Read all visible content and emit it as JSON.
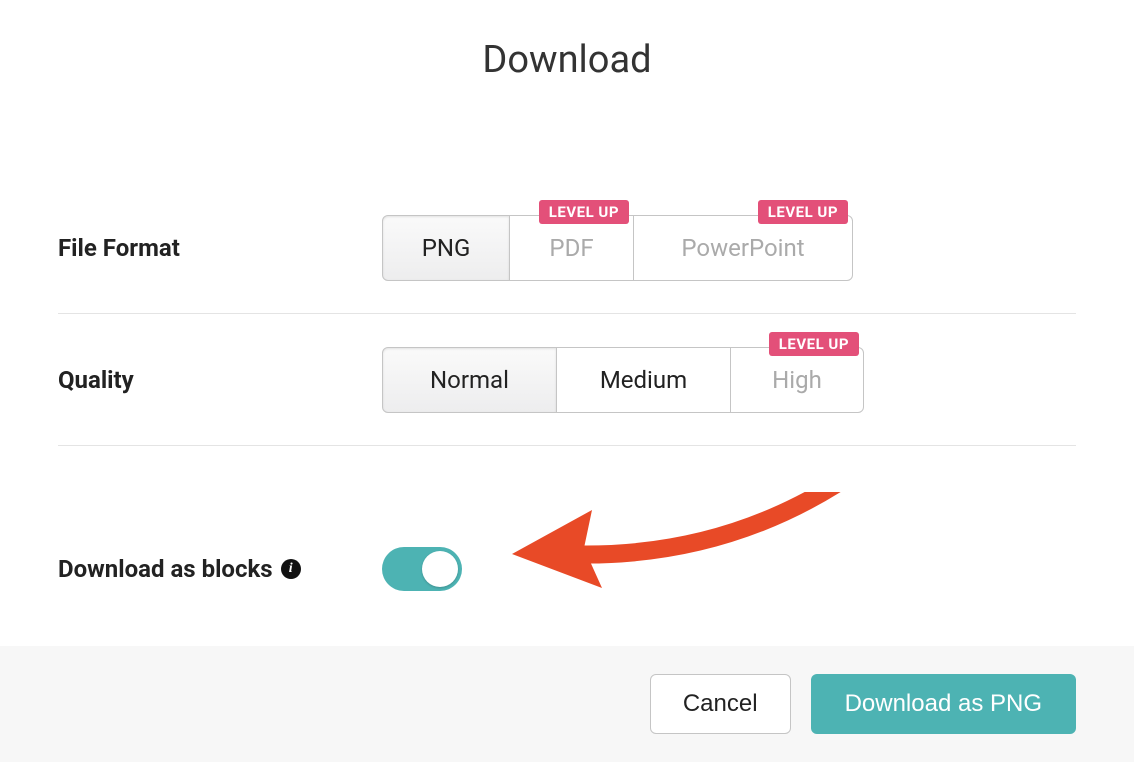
{
  "title": "Download",
  "rows": {
    "format": {
      "label": "File Format",
      "options": [
        {
          "label": "PNG",
          "badge": null
        },
        {
          "label": "PDF",
          "badge": "LEVEL UP"
        },
        {
          "label": "PowerPoint",
          "badge": "LEVEL UP"
        }
      ]
    },
    "quality": {
      "label": "Quality",
      "options": [
        {
          "label": "Normal",
          "badge": null
        },
        {
          "label": "Medium",
          "badge": null
        },
        {
          "label": "High",
          "badge": "LEVEL UP"
        }
      ]
    },
    "blocks": {
      "label": "Download as blocks"
    }
  },
  "footer": {
    "cancel": "Cancel",
    "download": "Download as PNG"
  }
}
